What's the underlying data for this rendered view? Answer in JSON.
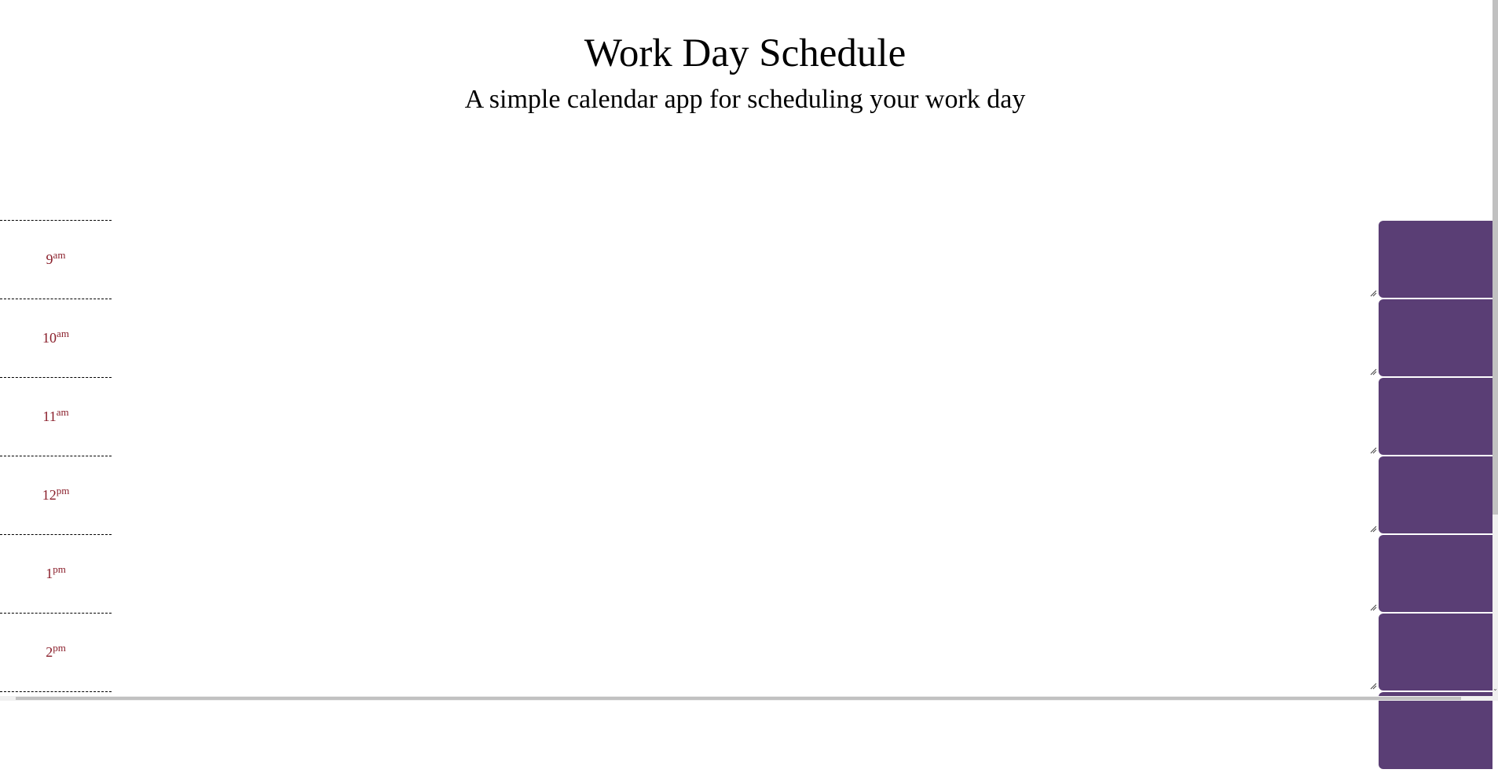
{
  "header": {
    "title": "Work Day Schedule",
    "subtitle": "A simple calendar app for scheduling your work day"
  },
  "colors": {
    "save_button": "#5a3e75",
    "hour_label": "#8a1f2b"
  },
  "icons": {
    "resize_handle": "resize-grip-icon",
    "scroll_arrow": "chevron-down-icon"
  },
  "scrollbar": {
    "down_arrow": "⌄"
  },
  "timeblocks": [
    {
      "hour": "9",
      "period": "am",
      "text": ""
    },
    {
      "hour": "10",
      "period": "am",
      "text": ""
    },
    {
      "hour": "11",
      "period": "am",
      "text": ""
    },
    {
      "hour": "12",
      "period": "pm",
      "text": ""
    },
    {
      "hour": "1",
      "period": "pm",
      "text": ""
    },
    {
      "hour": "2",
      "period": "pm",
      "text": ""
    },
    {
      "hour": "",
      "period": "",
      "text": ""
    }
  ]
}
